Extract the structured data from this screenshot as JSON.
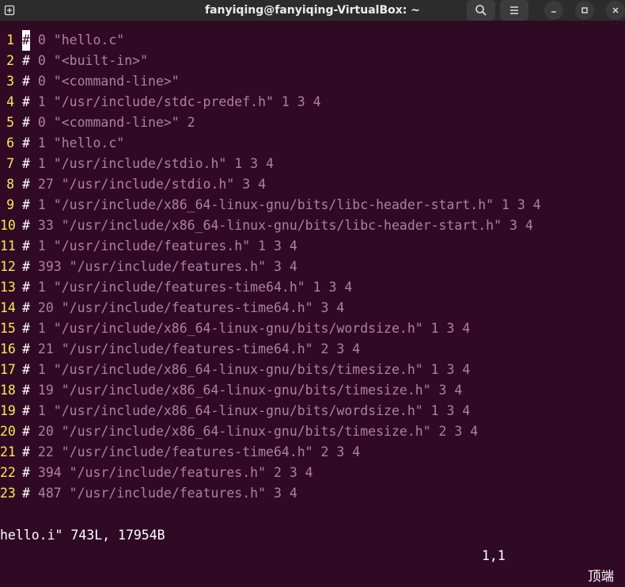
{
  "window": {
    "title": "fanyiqing@fanyiqing-VirtualBox: ~",
    "buttons": [
      "new-tab-icon",
      "search-icon",
      "hamburger-menu-icon",
      "minimize-icon",
      "maximize-icon",
      "close-icon"
    ]
  },
  "editor": {
    "lines": [
      {
        "num": "1",
        "hash": "#",
        "text": " 0 \"hello.c\""
      },
      {
        "num": "2",
        "hash": "#",
        "text": " 0 \"<built-in>\""
      },
      {
        "num": "3",
        "hash": "#",
        "text": " 0 \"<command-line>\""
      },
      {
        "num": "4",
        "hash": "#",
        "text": " 1 \"/usr/include/stdc-predef.h\" 1 3 4"
      },
      {
        "num": "5",
        "hash": "#",
        "text": " 0 \"<command-line>\" 2"
      },
      {
        "num": "6",
        "hash": "#",
        "text": " 1 \"hello.c\""
      },
      {
        "num": "7",
        "hash": "#",
        "text": " 1 \"/usr/include/stdio.h\" 1 3 4"
      },
      {
        "num": "8",
        "hash": "#",
        "text": " 27 \"/usr/include/stdio.h\" 3 4"
      },
      {
        "num": "9",
        "hash": "#",
        "text": " 1 \"/usr/include/x86_64-linux-gnu/bits/libc-header-start.h\" 1 3 4"
      },
      {
        "num": "10",
        "hash": "#",
        "text": " 33 \"/usr/include/x86_64-linux-gnu/bits/libc-header-start.h\" 3 4"
      },
      {
        "num": "11",
        "hash": "#",
        "text": " 1 \"/usr/include/features.h\" 1 3 4"
      },
      {
        "num": "12",
        "hash": "#",
        "text": " 393 \"/usr/include/features.h\" 3 4"
      },
      {
        "num": "13",
        "hash": "#",
        "text": " 1 \"/usr/include/features-time64.h\" 1 3 4"
      },
      {
        "num": "14",
        "hash": "#",
        "text": " 20 \"/usr/include/features-time64.h\" 3 4"
      },
      {
        "num": "15",
        "hash": "#",
        "text": " 1 \"/usr/include/x86_64-linux-gnu/bits/wordsize.h\" 1 3 4"
      },
      {
        "num": "16",
        "hash": "#",
        "text": " 21 \"/usr/include/features-time64.h\" 2 3 4"
      },
      {
        "num": "17",
        "hash": "#",
        "text": " 1 \"/usr/include/x86_64-linux-gnu/bits/timesize.h\" 1 3 4"
      },
      {
        "num": "18",
        "hash": "#",
        "text": " 19 \"/usr/include/x86_64-linux-gnu/bits/timesize.h\" 3 4"
      },
      {
        "num": "19",
        "hash": "#",
        "text": " 1 \"/usr/include/x86_64-linux-gnu/bits/wordsize.h\" 1 3 4"
      },
      {
        "num": "20",
        "hash": "#",
        "text": " 20 \"/usr/include/x86_64-linux-gnu/bits/timesize.h\" 2 3 4"
      },
      {
        "num": "21",
        "hash": "#",
        "text": " 22 \"/usr/include/features-time64.h\" 2 3 4"
      },
      {
        "num": "22",
        "hash": "#",
        "text": " 394 \"/usr/include/features.h\" 2 3 4"
      },
      {
        "num": "23",
        "hash": "#",
        "text": " 487 \"/usr/include/features.h\" 3 4"
      }
    ]
  },
  "status": {
    "file_info": "hello.i\" 743L, 17954B",
    "cursor_pos": "1,1",
    "scroll": "顶端"
  },
  "colors": {
    "background": "#300a24",
    "line_number": "#fce94f",
    "preproc": "#ad7fa8",
    "text": "#ffffff",
    "titlebar": "#2c2c2c"
  }
}
